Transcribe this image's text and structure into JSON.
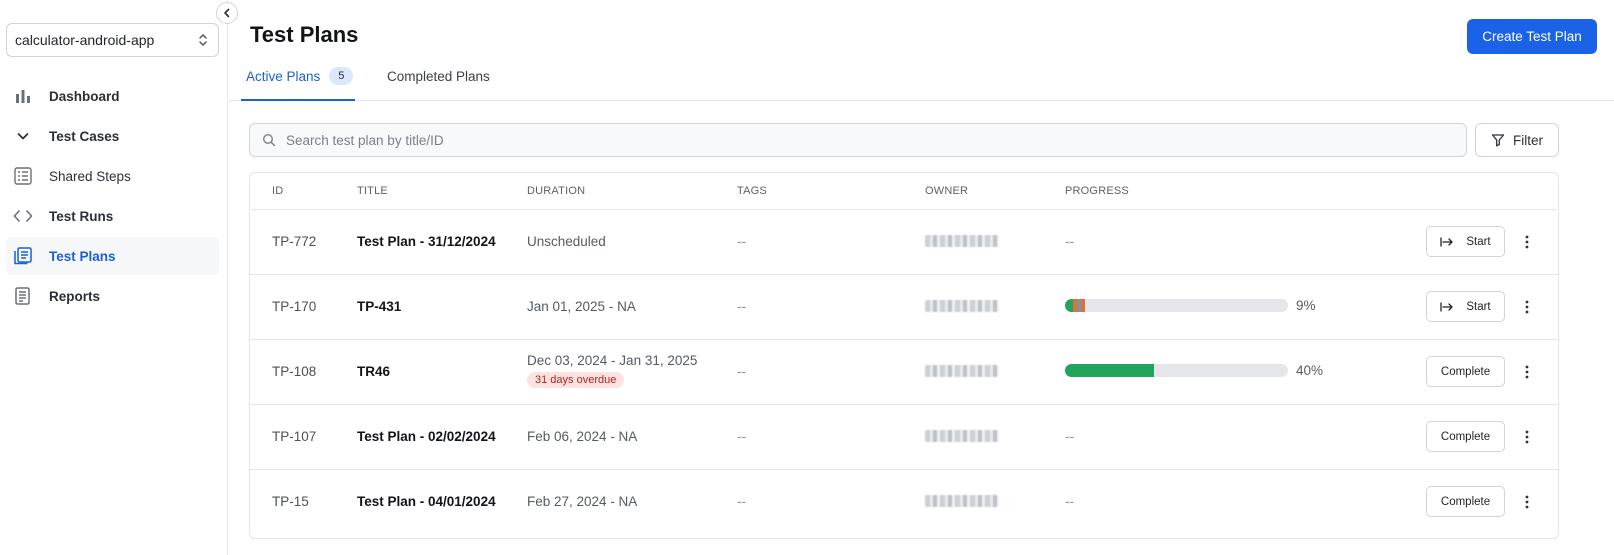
{
  "project": {
    "name": "calculator-android-app"
  },
  "sidebar": {
    "items": [
      {
        "label": "Dashboard",
        "icon": "bar-chart-icon"
      },
      {
        "label": "Test Cases",
        "icon": "chevron-down-icon"
      },
      {
        "label": "Shared Steps",
        "icon": "list-steps-icon"
      },
      {
        "label": "Test Runs",
        "icon": "code-brackets-icon"
      },
      {
        "label": "Test Plans",
        "icon": "test-plans-icon",
        "active": true
      },
      {
        "label": "Reports",
        "icon": "report-icon"
      }
    ]
  },
  "header": {
    "title": "Test Plans",
    "create_label": "Create Test Plan"
  },
  "tabs": [
    {
      "label": "Active Plans",
      "count": "5",
      "active": true
    },
    {
      "label": "Completed Plans"
    }
  ],
  "search": {
    "placeholder": "Search test plan by title/ID"
  },
  "filter_label": "Filter",
  "table": {
    "columns": [
      "ID",
      "TITLE",
      "DURATION",
      "TAGS",
      "OWNER",
      "PROGRESS"
    ],
    "rows": [
      {
        "id": "TP-772",
        "title": "Test Plan - 31/12/2024",
        "duration": "Unscheduled",
        "tags": "--",
        "progress_text": "--",
        "action": "Start"
      },
      {
        "id": "TP-170",
        "title": "TP-431",
        "duration": "Jan 01, 2025 - NA",
        "tags": "--",
        "progress": 9,
        "progress_label": "9%",
        "action": "Start"
      },
      {
        "id": "TP-108",
        "title": "TR46",
        "duration": "Dec 03, 2024 - Jan 31, 2025",
        "overdue": "31 days overdue",
        "tags": "--",
        "progress": 40,
        "progress_label": "40%",
        "action": "Complete"
      },
      {
        "id": "TP-107",
        "title": "Test Plan - 02/02/2024",
        "duration": "Feb 06, 2024 - NA",
        "tags": "--",
        "progress_text": "--",
        "action": "Complete"
      },
      {
        "id": "TP-15",
        "title": "Test Plan - 04/01/2024",
        "duration": "Feb 27, 2024 - NA",
        "tags": "--",
        "progress_text": "--",
        "action": "Complete"
      }
    ]
  },
  "colors": {
    "accent": "#1a63e8",
    "progress_green": "#22a55b",
    "progress_orange": "#e0703a",
    "progress_gray": "#8b8f96"
  }
}
